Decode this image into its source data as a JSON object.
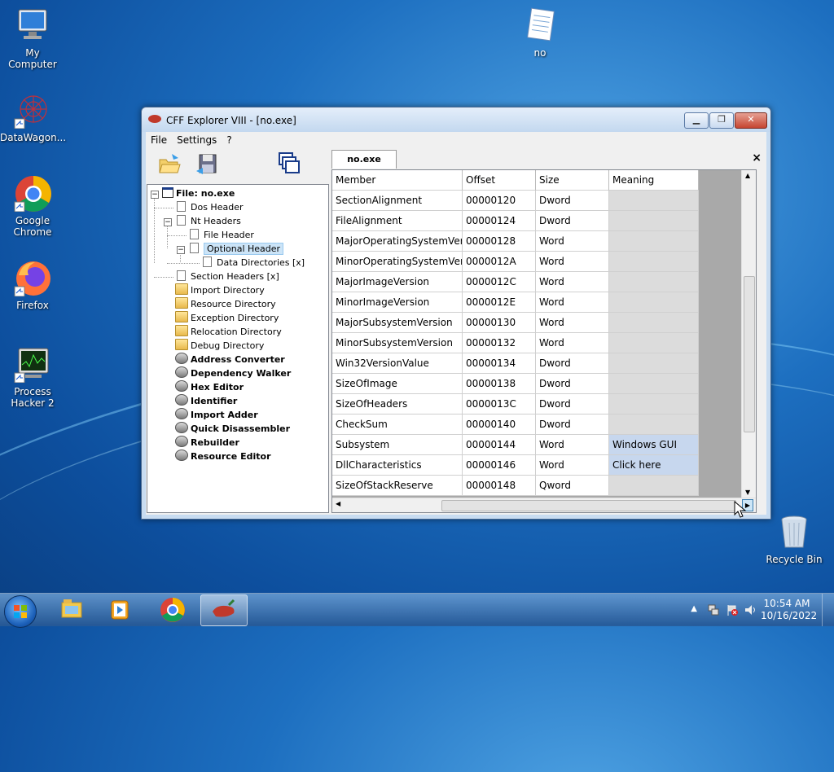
{
  "desktop": {
    "icons": [
      {
        "label": "My Computer",
        "icon": "computer-icon"
      },
      {
        "label": "no",
        "icon": "notepad-file-icon"
      },
      {
        "label": "DataWagon...",
        "icon": "datawagon-icon"
      },
      {
        "label": "Google Chrome",
        "icon": "chrome-icon"
      },
      {
        "label": "Firefox",
        "icon": "firefox-icon"
      },
      {
        "label": "Process Hacker 2",
        "icon": "process-hacker-icon"
      },
      {
        "label": "Recycle Bin",
        "icon": "recycle-bin-icon"
      }
    ]
  },
  "window": {
    "title": "CFF Explorer VIII - [no.exe]",
    "menu": [
      "File",
      "Settings",
      "?"
    ],
    "toolbar": [
      "open-folder-icon",
      "save-disk-icon",
      "windows-stack-icon"
    ],
    "tab_label": "no.exe",
    "tab_close": "×",
    "tree": [
      {
        "label": "File: no.exe",
        "bold": true
      },
      {
        "label": "Dos Header"
      },
      {
        "label": "Nt Headers"
      },
      {
        "label": "File Header"
      },
      {
        "label": "Optional Header",
        "selected": true
      },
      {
        "label": "Data Directories [x]"
      },
      {
        "label": "Section Headers [x]"
      },
      {
        "label": "Import Directory"
      },
      {
        "label": "Resource Directory"
      },
      {
        "label": "Exception Directory"
      },
      {
        "label": "Relocation Directory"
      },
      {
        "label": "Debug Directory"
      },
      {
        "label": "Address Converter",
        "bold": true
      },
      {
        "label": "Dependency Walker",
        "bold": true
      },
      {
        "label": "Hex Editor",
        "bold": true
      },
      {
        "label": "Identifier",
        "bold": true
      },
      {
        "label": "Import Adder",
        "bold": true
      },
      {
        "label": "Quick Disassembler",
        "bold": true
      },
      {
        "label": "Rebuilder",
        "bold": true
      },
      {
        "label": "Resource Editor",
        "bold": true
      }
    ],
    "grid": {
      "columns": [
        "Member",
        "Offset",
        "Size",
        "Meaning"
      ],
      "rows": [
        [
          "SectionAlignment",
          "00000120",
          "Dword",
          ""
        ],
        [
          "FileAlignment",
          "00000124",
          "Dword",
          ""
        ],
        [
          "MajorOperatingSystemVers...",
          "00000128",
          "Word",
          ""
        ],
        [
          "MinorOperatingSystemVer...",
          "0000012A",
          "Word",
          ""
        ],
        [
          "MajorImageVersion",
          "0000012C",
          "Word",
          ""
        ],
        [
          "MinorImageVersion",
          "0000012E",
          "Word",
          ""
        ],
        [
          "MajorSubsystemVersion",
          "00000130",
          "Word",
          ""
        ],
        [
          "MinorSubsystemVersion",
          "00000132",
          "Word",
          ""
        ],
        [
          "Win32VersionValue",
          "00000134",
          "Dword",
          ""
        ],
        [
          "SizeOfImage",
          "00000138",
          "Dword",
          ""
        ],
        [
          "SizeOfHeaders",
          "0000013C",
          "Dword",
          ""
        ],
        [
          "CheckSum",
          "00000140",
          "Dword",
          ""
        ],
        [
          "Subsystem",
          "00000144",
          "Word",
          "Windows GUI"
        ],
        [
          "DllCharacteristics",
          "00000146",
          "Word",
          "Click here"
        ],
        [
          "SizeOfStackReserve",
          "00000148",
          "Qword",
          ""
        ]
      ]
    }
  },
  "taskbar": {
    "items": [
      "explorer-icon",
      "media-player-icon",
      "chrome-icon",
      "cff-explorer-icon"
    ],
    "time": "10:54 AM",
    "date": "10/16/2022"
  }
}
